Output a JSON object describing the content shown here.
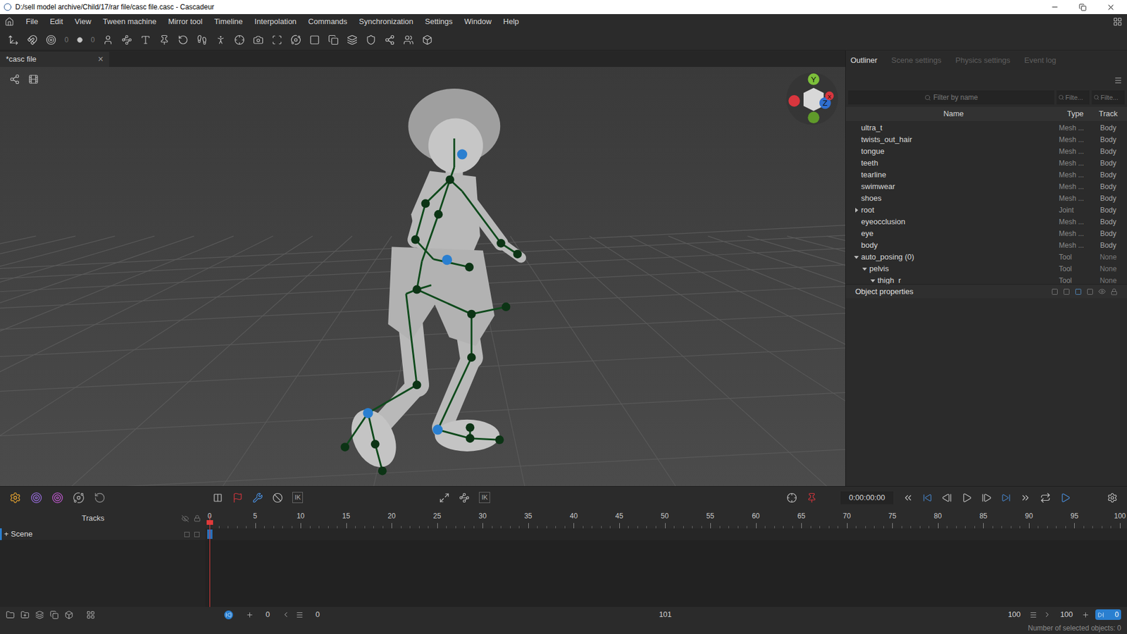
{
  "window": {
    "title": "D:/sell model archive/Child/17/rar file/casc file.casc - Cascadeur"
  },
  "menu": [
    "File",
    "Edit",
    "View",
    "Tween machine",
    "Mirror tool",
    "Timeline",
    "Interpolation",
    "Commands",
    "Synchronization",
    "Settings",
    "Window",
    "Help"
  ],
  "toolbar": {
    "fields": [
      "0",
      "0"
    ]
  },
  "document_tab": {
    "label": "*casc file",
    "close": "×"
  },
  "viewport": {
    "gizmo": [
      {
        "label": "Y",
        "color": "#7cbf3a"
      },
      {
        "label": "Z",
        "color": "#2f6fd0"
      },
      {
        "label": "X",
        "color": "#d9363e"
      }
    ]
  },
  "panel_tabs": [
    {
      "label": "Outliner",
      "selected": true
    },
    {
      "label": "Scene settings",
      "selected": false
    },
    {
      "label": "Physics settings",
      "selected": false
    },
    {
      "label": "Event log",
      "selected": false
    }
  ],
  "outliner": {
    "filters": [
      "Filter by name",
      "Filte...",
      "Filte..."
    ],
    "columns": [
      "Name",
      "Type",
      "Track"
    ],
    "rows": [
      {
        "name": "ultra_t",
        "type": "Mesh ...",
        "track": "Body",
        "depth": 0,
        "expandable": false,
        "expanded": false
      },
      {
        "name": "twists_out_hair",
        "type": "Mesh ...",
        "track": "Body",
        "depth": 0,
        "expandable": false,
        "expanded": false
      },
      {
        "name": "tongue",
        "type": "Mesh ...",
        "track": "Body",
        "depth": 0,
        "expandable": false,
        "expanded": false
      },
      {
        "name": "teeth",
        "type": "Mesh ...",
        "track": "Body",
        "depth": 0,
        "expandable": false,
        "expanded": false
      },
      {
        "name": "tearline",
        "type": "Mesh ...",
        "track": "Body",
        "depth": 0,
        "expandable": false,
        "expanded": false
      },
      {
        "name": "swimwear",
        "type": "Mesh ...",
        "track": "Body",
        "depth": 0,
        "expandable": false,
        "expanded": false
      },
      {
        "name": "shoes",
        "type": "Mesh ...",
        "track": "Body",
        "depth": 0,
        "expandable": false,
        "expanded": false
      },
      {
        "name": "root",
        "type": "Joint",
        "track": "Body",
        "depth": 0,
        "expandable": true,
        "expanded": false
      },
      {
        "name": "eyeocclusion",
        "type": "Mesh ...",
        "track": "Body",
        "depth": 0,
        "expandable": false,
        "expanded": false
      },
      {
        "name": "eye",
        "type": "Mesh ...",
        "track": "Body",
        "depth": 0,
        "expandable": false,
        "expanded": false
      },
      {
        "name": "body",
        "type": "Mesh ...",
        "track": "Body",
        "depth": 0,
        "expandable": false,
        "expanded": false
      },
      {
        "name": "auto_posing (0)",
        "type": "Tool",
        "track": "None",
        "depth": 0,
        "expandable": true,
        "expanded": true
      },
      {
        "name": "pelvis",
        "type": "Tool",
        "track": "None",
        "depth": 1,
        "expandable": true,
        "expanded": true
      },
      {
        "name": "thigh_r",
        "type": "Tool",
        "track": "None",
        "depth": 2,
        "expandable": true,
        "expanded": true
      }
    ]
  },
  "object_properties": {
    "title": "Object properties"
  },
  "transport": {
    "ik_labels": [
      "IK",
      "IK"
    ],
    "time": "0:00:00:00"
  },
  "timeline": {
    "tracks_label": "Tracks",
    "ticks": [
      "0",
      "5",
      "10",
      "15",
      "20",
      "25",
      "30",
      "35",
      "40",
      "45",
      "50",
      "55",
      "60",
      "65",
      "70",
      "75",
      "80",
      "85",
      "90",
      "95",
      "100"
    ],
    "tracks": [
      {
        "label": "Scene",
        "expand": "+",
        "selected": true
      }
    ]
  },
  "range_bar": {
    "start_values": [
      "0",
      "0"
    ],
    "center": "101",
    "end_values": [
      "100",
      "100"
    ],
    "loop": "0"
  },
  "status_bar": "Number of selected objects: 0"
}
